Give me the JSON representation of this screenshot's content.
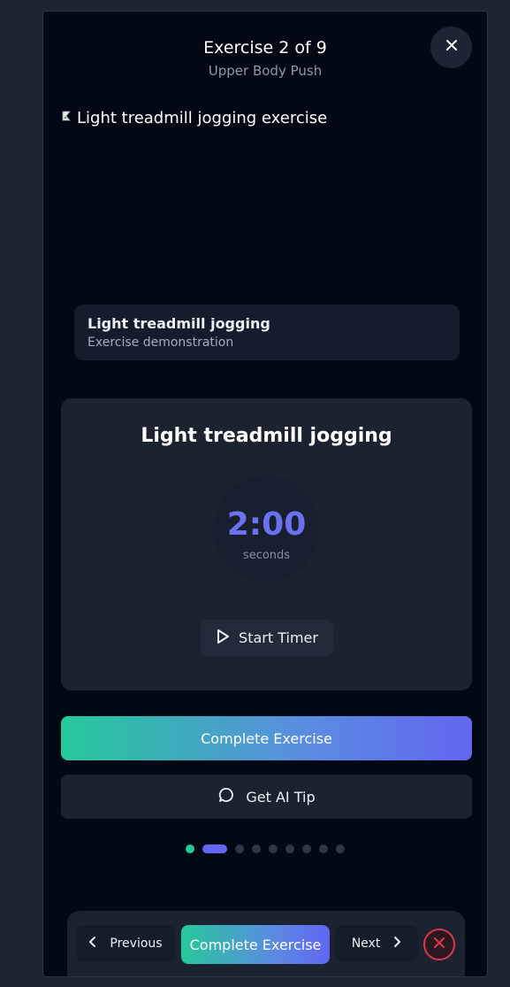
{
  "header": {
    "title": "Exercise 2 of 9",
    "workout_name": "Upper Body Push",
    "close_icon": "close-icon"
  },
  "media": {
    "image_alt": "Light treadmill jogging exercise",
    "caption_title": "Light treadmill jogging",
    "caption_subtitle": "Exercise demonstration"
  },
  "timer": {
    "exercise_name": "Light treadmill jogging",
    "value": "2:00",
    "unit": "seconds",
    "start_label": "Start Timer",
    "accent_color": "#6366f1"
  },
  "actions": {
    "complete_label": "Complete Exercise",
    "ai_tip_label": "Get AI Tip"
  },
  "progress": {
    "total": 9,
    "current_index": 2,
    "completed": 1,
    "completed_color": "#25c99a",
    "current_color": "#6366f1"
  },
  "bottom_nav": {
    "previous_label": "Previous",
    "complete_label": "Complete Exercise",
    "next_label": "Next",
    "quit_color": "#e0364b"
  }
}
